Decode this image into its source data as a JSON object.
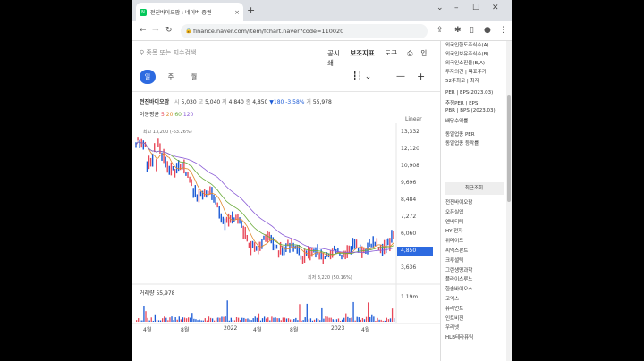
{
  "browser": {
    "tab_title": "전진바이오팜 : 네이버 증권",
    "tab_close": "×",
    "new_tab": "+",
    "url": "finance.naver.com/item/fchart.naver?code=110020"
  },
  "toolbar": {
    "search_placeholder": "종목 또는 지수검색",
    "menu": [
      "공시",
      "보조지표",
      "도구",
      "인쇄"
    ]
  },
  "period_tabs": [
    "일",
    "주",
    "월"
  ],
  "quote": {
    "name": "전진바이오팜",
    "open_label": "시",
    "open": "5,030",
    "high_label": "고",
    "high": "5,040",
    "low_label": "저",
    "low": "4,840",
    "close_label": "종",
    "close": "4,850",
    "change": "▼180 -3.58%",
    "volume_label": "거",
    "volume": "55,978"
  },
  "moving_average": {
    "label": "이동평균",
    "periods": [
      "5",
      "20",
      "60",
      "120"
    ]
  },
  "scale_label": "Linear",
  "y_ticks": [
    "13,332",
    "12,120",
    "10,908",
    "9,696",
    "8,484",
    "7,272",
    "6,060",
    "4,850",
    "3,636"
  ],
  "current_price_tag": "4,850",
  "max_label": "최고 13,200 (-63.26%)",
  "min_label": "최저 3,220 (50.16%)",
  "volume_label": "거래량 55,978",
  "volume_max": "1.19m",
  "x_ticks": [
    "4월",
    "8월",
    "2022",
    "4월",
    "8월",
    "2023",
    "4월"
  ],
  "colors": {
    "accent": "#2d6ae0",
    "candle_up": "#e8495a",
    "candle_down": "#1a5ad6",
    "ma5": "#e8495a",
    "ma20": "#e08a2e",
    "ma60": "#6aab3a",
    "ma120": "#8a5cd6"
  },
  "side": {
    "items_top": [
      "외국인한도주식수(A)",
      "외국인보유주식수(B)",
      "외국인소진율(B/A)",
      "투자의견 | 목표주가",
      "52주최고 | 최저",
      "PER | EPS(2023.03)",
      "추정PER | EPS",
      "PBR | BPS (2023.03)",
      "배당수익률",
      "동일업종 PER",
      "동일업종 등락률"
    ],
    "recent_header": "최근조회",
    "recent": [
      "전진바이오팜",
      "오픈실업",
      "엔비티텍",
      "HY 전자",
      "위메이드",
      "씨엑스판트",
      "크루셜텍",
      "그린생명과학",
      "플라이스루노",
      "한솔바이오스",
      "코엑스",
      "퓨리언트",
      "인트비전",
      "우리넷",
      "HLB테라퓨틱"
    ]
  }
}
